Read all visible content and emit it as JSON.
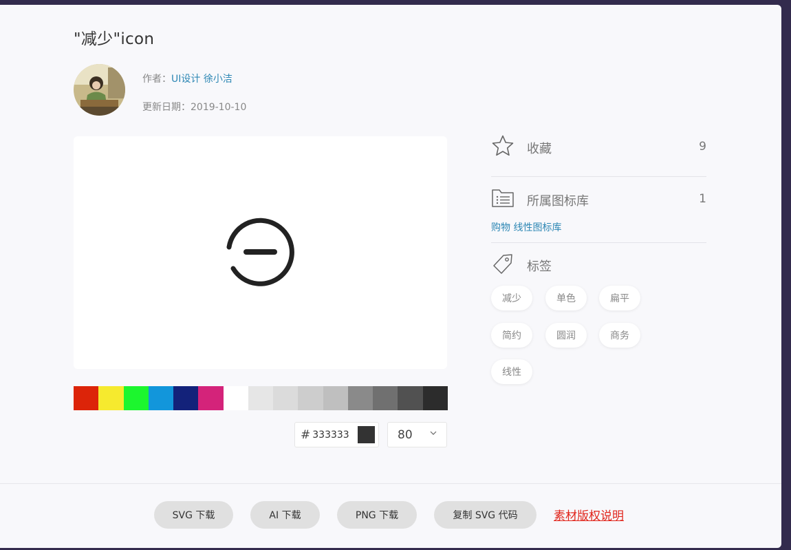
{
  "title": "\"减少\"icon",
  "author": {
    "label": "作者：",
    "name": "UI设计 徐小洁"
  },
  "updated": {
    "label": "更新日期：",
    "date": "2019-10-10"
  },
  "preview": {
    "icon": "minus-circle-icon",
    "color": "#333333"
  },
  "palette": [
    "#dc2409",
    "#f6ea2e",
    "#1cf62e",
    "#1296db",
    "#13227a",
    "#d4237a",
    "#ffffff",
    "#e6e6e6",
    "#dbdbdb",
    "#cdcdcd",
    "#bfbfbf",
    "#8a8a8a",
    "#707070",
    "#515151",
    "#2c2c2c"
  ],
  "color_input": {
    "hash": "#",
    "value": "333333",
    "chip": "#333333"
  },
  "size_select": {
    "value": "80"
  },
  "stats": {
    "favorites": {
      "label": "收藏",
      "count": "9"
    },
    "libraries": {
      "label": "所属图标库",
      "count": "1",
      "link": "购物 线性图标库"
    },
    "tags": {
      "label": "标签",
      "items": [
        "减少",
        "单色",
        "扁平",
        "简约",
        "圆润",
        "商务",
        "线性"
      ]
    }
  },
  "footer": {
    "buttons": [
      "SVG 下载",
      "AI 下载",
      "PNG 下载",
      "复制 SVG 代码"
    ],
    "copyright_link": "素材版权说明"
  }
}
